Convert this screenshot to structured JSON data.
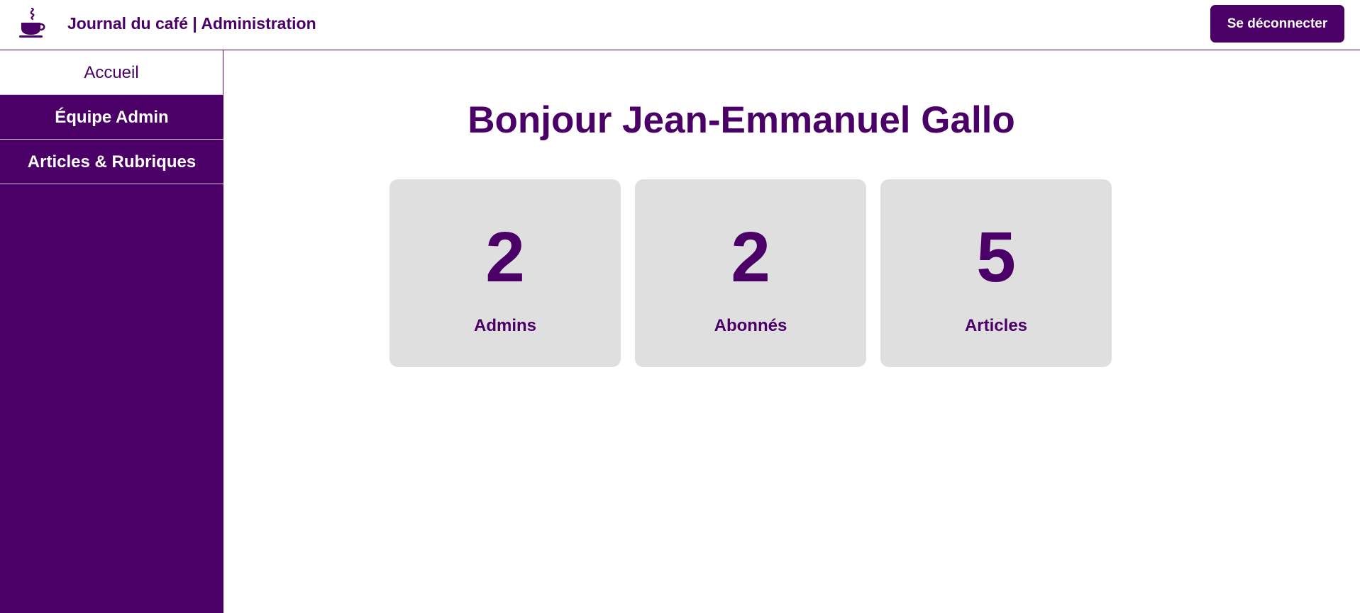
{
  "header": {
    "logo_icon": "coffee-cup-icon",
    "title": "Journal du café | Administration",
    "logout_label": "Se déconnecter"
  },
  "sidebar": {
    "items": [
      {
        "label": "Accueil",
        "active": true
      },
      {
        "label": "Équipe Admin",
        "active": false
      },
      {
        "label": "Articles & Rubriques",
        "active": false
      }
    ]
  },
  "main": {
    "greeting": "Bonjour Jean-Emmanuel Gallo",
    "stats": [
      {
        "count": "2",
        "label": "Admins"
      },
      {
        "count": "2",
        "label": "Abonnés"
      },
      {
        "count": "5",
        "label": "Articles"
      }
    ]
  },
  "colors": {
    "primary": "#4b0068",
    "card_background": "#dfdfdf",
    "background": "#ffffff"
  }
}
